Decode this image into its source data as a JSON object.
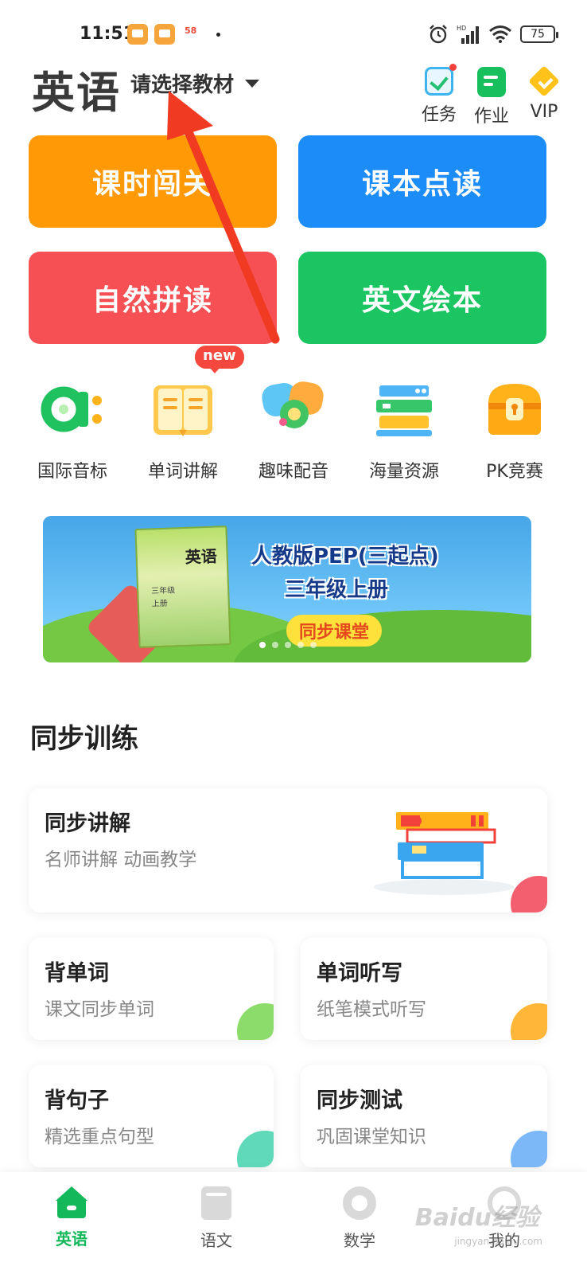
{
  "status_bar": {
    "time": "11:51",
    "notif_58": "58",
    "battery": "75",
    "hd": "HD"
  },
  "header": {
    "title": "英语",
    "book_select": "请选择教材",
    "actions": [
      {
        "label": "任务",
        "icon": "task-check-icon"
      },
      {
        "label": "作业",
        "icon": "homework-icon"
      },
      {
        "label": "VIP",
        "icon": "vip-diamond-icon"
      }
    ]
  },
  "main_buttons": [
    {
      "label": "课时闯关",
      "color": "#ff9a06"
    },
    {
      "label": "课本点读",
      "color": "#1c8cf8"
    },
    {
      "label": "自然拼读",
      "color": "#f65055"
    },
    {
      "label": "英文绘本",
      "color": "#1bc561"
    }
  ],
  "features": [
    {
      "label": "国际音标",
      "icon": "phonetic-icon"
    },
    {
      "label": "单词讲解",
      "icon": "open-book-icon",
      "badge": "new"
    },
    {
      "label": "趣味配音",
      "icon": "dubbing-icon"
    },
    {
      "label": "海量资源",
      "icon": "book-stack-icon"
    },
    {
      "label": "PK竞赛",
      "icon": "treasure-chest-icon"
    }
  ],
  "banner": {
    "book_title": "英语",
    "book_grade": "三年级",
    "book_volume": "上册",
    "title_line1": "人教版PEP(三起点)",
    "title_line2": "三年级上册",
    "cta": "同步课堂",
    "slide_count": 5,
    "active_slide": 1
  },
  "section": {
    "title": "同步训练",
    "cards": [
      {
        "title": "同步讲解",
        "subtitle": "名师讲解  动画教学",
        "corner_color": "#f45f6f"
      },
      {
        "title": "背单词",
        "subtitle": "课文同步单词",
        "corner_color": "#8bdc6a"
      },
      {
        "title": "单词听写",
        "subtitle": "纸笔模式听写",
        "corner_color": "#ffb639"
      },
      {
        "title": "背句子",
        "subtitle": "精选重点句型",
        "corner_color": "#5fd9b8"
      },
      {
        "title": "同步测试",
        "subtitle": "巩固课堂知识",
        "corner_color": "#7cb8f8"
      }
    ]
  },
  "bottom_nav": [
    {
      "label": "英语",
      "active": true
    },
    {
      "label": "语文",
      "active": false
    },
    {
      "label": "数学",
      "active": false
    },
    {
      "label": "我的",
      "active": false
    }
  ],
  "watermark": {
    "text": "Baidu经验",
    "sub": "jingyan.baidu.com"
  },
  "colors": {
    "accent_green": "#12b85a",
    "arrow_red": "#f03a22"
  }
}
